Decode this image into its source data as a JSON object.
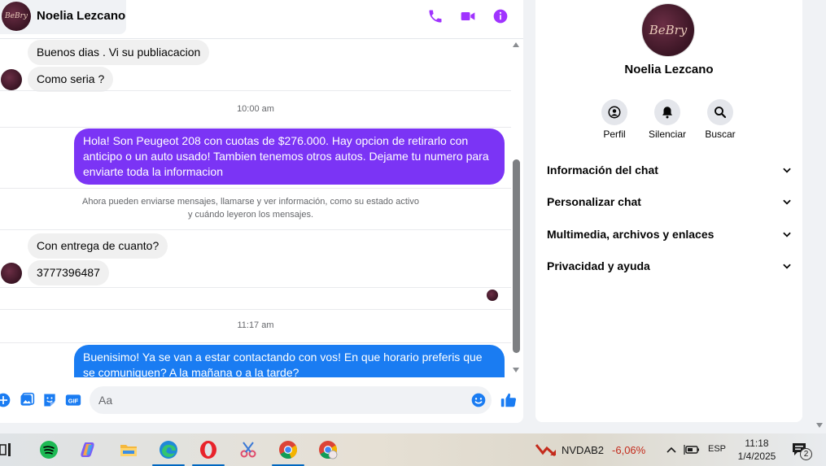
{
  "contact": {
    "name": "Noelia Lezcano",
    "avatar_brand": "BeBry"
  },
  "colors": {
    "accent_purple": "#a033ff",
    "bubble_purple": "#7b34f5",
    "bubble_blue": "#1a7cf2",
    "bubble_incoming": "#f0f0f0",
    "ticker_negative": "#c42b1c"
  },
  "header_icons": [
    "phone-icon",
    "video-camera-icon",
    "info-icon"
  ],
  "messages": {
    "m1": "Buenos dias . Vi su publiacacion",
    "m2": "Como seria ?",
    "ts1": "10:00 am",
    "m3": "Hola! Son Peugeot 208 con cuotas de $276.000. Hay opcion de retirarlo con anticipo o un auto usado! Tambien tenemos otros autos. Dejame tu numero para enviarte toda la informacion",
    "notice_line1": "Ahora pueden enviarse mensajes, llamarse y ver información, como su estado activo",
    "notice_line2": "y cuándo leyeron los mensajes.",
    "m4": "Con entrega de cuanto?",
    "m5": "3777396487",
    "ts2": "11:17 am",
    "m6": "Buenisimo! Ya se van a estar contactando con vos! En que horario preferis que se comuniquen? A la mañana o a la tarde?"
  },
  "composer": {
    "placeholder": "Aa",
    "gif_label": "GIF",
    "icons": [
      "plus-icon",
      "image-icon",
      "sticker-icon",
      "gif-icon",
      "emoji-icon",
      "like-icon"
    ]
  },
  "info_panel": {
    "name": "Noelia Lezcano",
    "actions": [
      {
        "label": "Perfil",
        "icon": "profile-icon"
      },
      {
        "label": "Silenciar",
        "icon": "bell-icon"
      },
      {
        "label": "Buscar",
        "icon": "search-icon"
      }
    ],
    "sections": [
      "Información del chat",
      "Personalizar chat",
      "Multimedia, archivos y enlaces",
      "Privacidad y ayuda"
    ]
  },
  "taskbar": {
    "apps": [
      "task-view-icon",
      "spotify-icon",
      "copilot-icon",
      "file-explorer-icon",
      "edge-icon",
      "opera-icon",
      "snipping-tool-icon",
      "chrome-icon",
      "chrome-profile-icon"
    ],
    "ticker": {
      "symbol": "NVDAB2",
      "change": "-6,06%"
    },
    "language": "ESP",
    "time": "11:18",
    "date": "1/4/2025",
    "notifications": "2"
  }
}
